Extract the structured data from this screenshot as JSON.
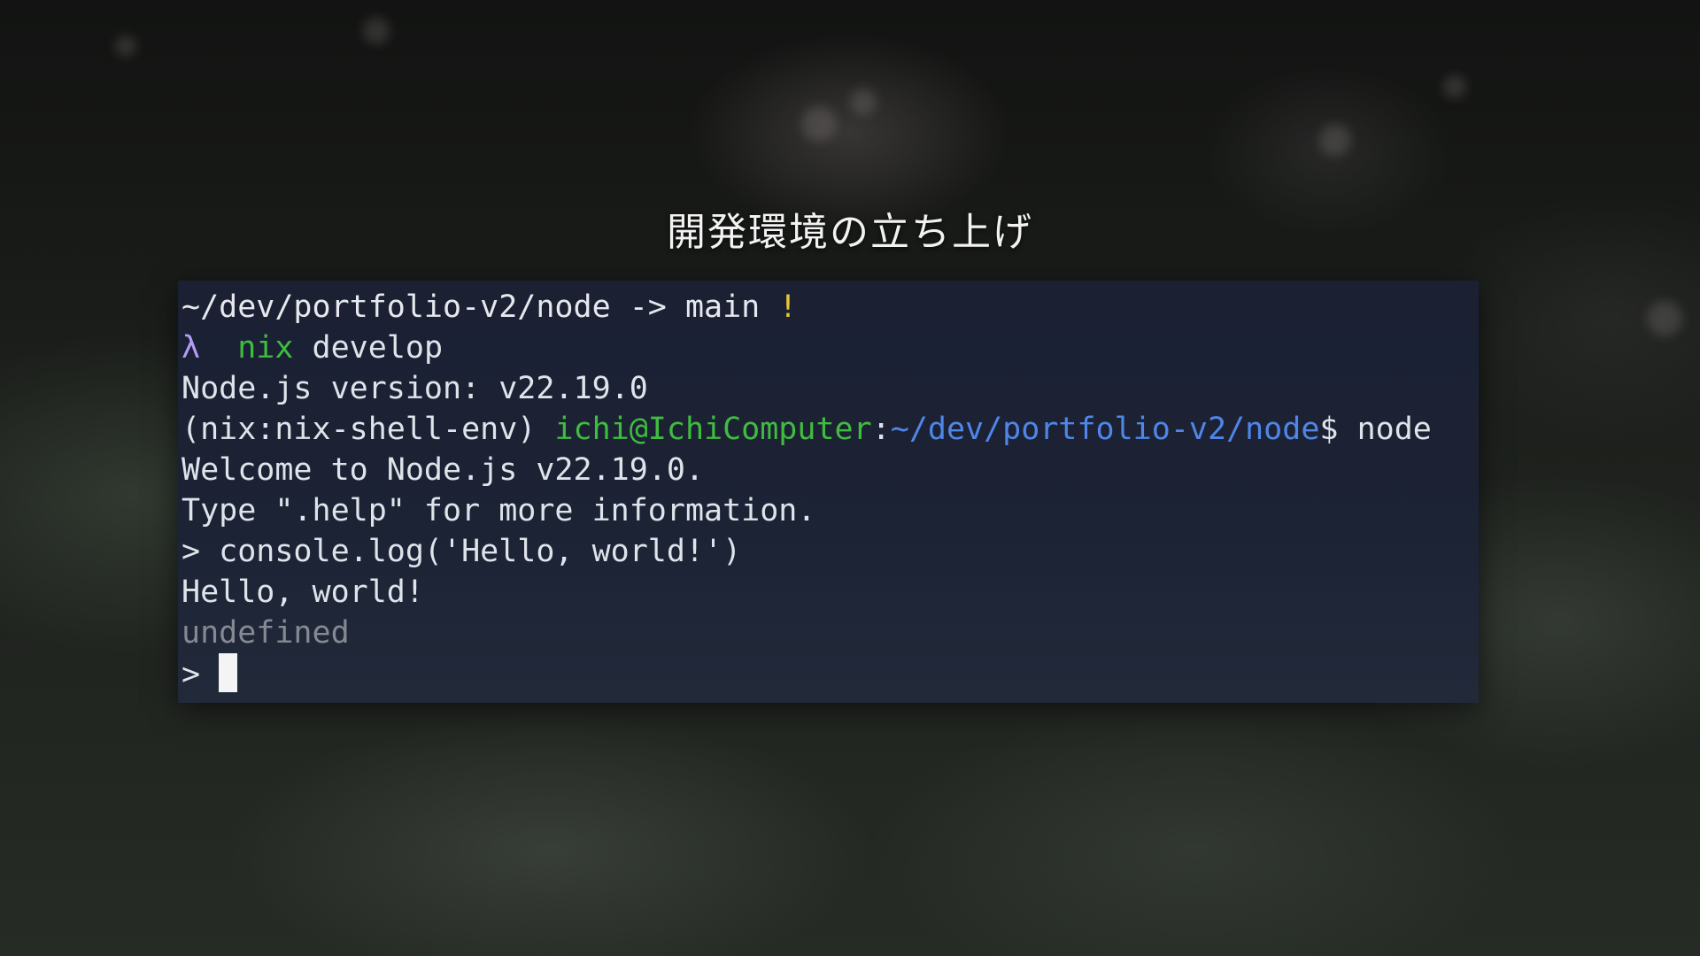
{
  "title": "開発環境の立ち上げ",
  "terminal": {
    "line1": {
      "path": "~/dev/portfolio-v2/node",
      "arrow": " -> ",
      "branch": "main",
      "status_mark": "!"
    },
    "line2": {
      "prompt_symbol": "λ",
      "command": "nix",
      "argument": "develop"
    },
    "line3": "Node.js version: v22.19.0",
    "line4": {
      "env": "(nix:nix-shell-env) ",
      "user_host": "ichi@IchiComputer",
      "colon": ":",
      "cwd": "~/dev/portfolio-v2/node",
      "prompt_end": "$ ",
      "command": "node"
    },
    "line5": "Welcome to Node.js v22.19.0.",
    "line6": "Type \".help\" for more information.",
    "line7": "> console.log('Hello, world!')",
    "line8": "Hello, world!",
    "line9": "undefined",
    "line10_prompt": "> "
  },
  "colors": {
    "terminal_bg": "#1c2335",
    "prompt_purple": "#b49cf6",
    "status_yellow": "#e7c43a",
    "user_green": "#3fbd3f",
    "path_blue": "#4f86e8",
    "undefined_gray": "#858a92"
  }
}
